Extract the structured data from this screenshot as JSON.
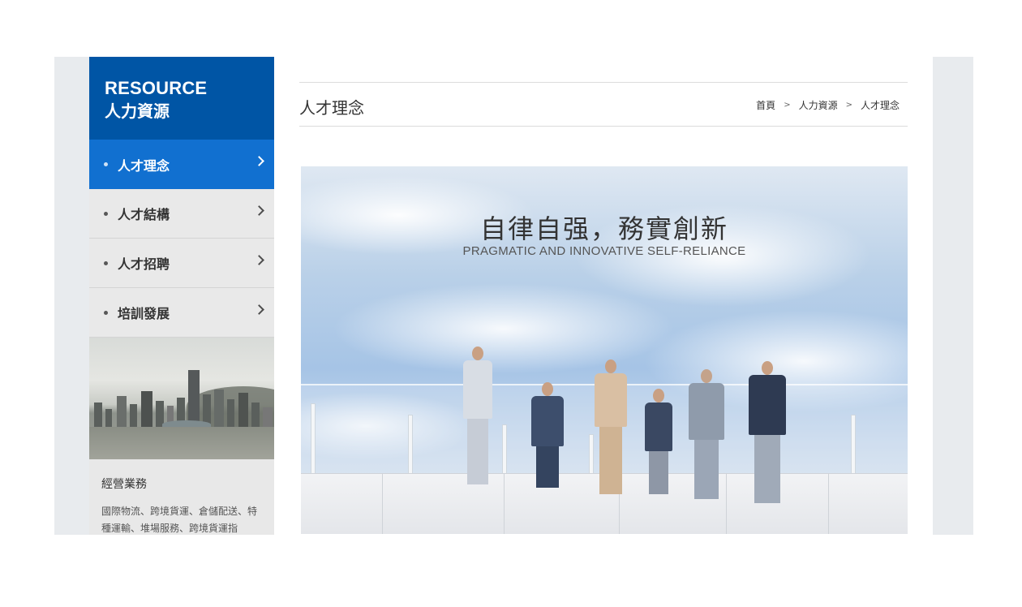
{
  "sidebar": {
    "header_en": "RESOURCE",
    "header_zh": "人力資源",
    "items": [
      {
        "label": "人才理念",
        "active": true
      },
      {
        "label": "人才結構",
        "active": false
      },
      {
        "label": "人才招聘",
        "active": false
      },
      {
        "label": "培訓發展",
        "active": false
      }
    ],
    "business_title": "經營業務",
    "business_text": "國際物流、跨境貨運、倉儲配送、特種運輸、堆場服務、跨境貨運指"
  },
  "main": {
    "page_title": "人才理念",
    "breadcrumb": [
      "首頁",
      "人力資源",
      "人才理念"
    ],
    "breadcrumb_sep": ">",
    "banner_zh": "自律自强，務實創新",
    "banner_en": "PRAGMATIC AND INNOVATIVE SELF-RELIANCE"
  },
  "colors": {
    "header_blue": "#0055a5",
    "active_blue": "#1170d0",
    "sidebar_bg": "#e9e9e9",
    "frame_bg": "#e8ebee"
  },
  "icons": {
    "menu_chevron": "chevron-right-icon",
    "menu_bullet": "bullet-dot-icon"
  }
}
